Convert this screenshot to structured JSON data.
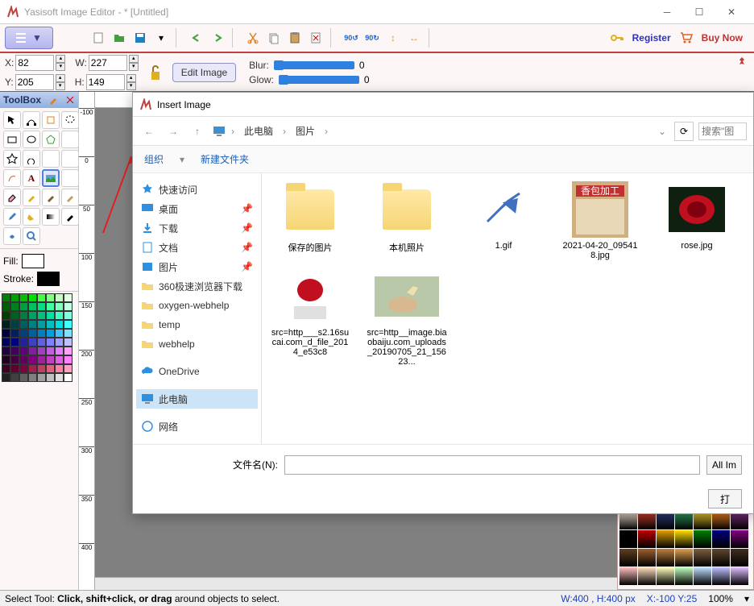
{
  "window": {
    "title": "Yasisoft Image Editor - * [Untitled]"
  },
  "toolbar": {
    "register": "Register",
    "buynow": "Buy Now"
  },
  "coords": {
    "x_label": "X:",
    "x": "82",
    "y_label": "Y:",
    "y": "205",
    "w_label": "W:",
    "w": "227",
    "h_label": "H:",
    "h": "149",
    "edit_image": "Edit Image",
    "blur_label": "Blur:",
    "blur_value": "0",
    "glow_label": "Glow:",
    "glow_value": "0"
  },
  "toolbox": {
    "title": "ToolBox",
    "fill_label": "Fill:",
    "stroke_label": "Stroke:"
  },
  "ruler_marks": [
    "-100",
    "0",
    "50",
    "100",
    "150",
    "200",
    "250",
    "300",
    "350",
    "400"
  ],
  "dialog": {
    "title": "Insert Image",
    "crumb1": "此电脑",
    "crumb2": "图片",
    "search_ph": "搜索\"图",
    "organize": "组织",
    "newfolder": "新建文件夹",
    "side": {
      "quick": "快速访问",
      "desktop": "桌面",
      "downloads": "下载",
      "documents": "文档",
      "pictures": "图片",
      "s360": "360极速浏览器下载",
      "oxygen": "oxygen-webhelp",
      "temp": "temp",
      "webhelp": "webhelp",
      "onedrive": "OneDrive",
      "thispc": "此电脑",
      "network": "网络"
    },
    "files": {
      "f1": "保存的图片",
      "f2": "本机照片",
      "f3": "1.gif",
      "f4": "2021-04-20_095418.jpg",
      "f5": "rose.jpg",
      "f6": "src=http___s2.16sucai.com_d_file_2014_e53c8",
      "f7": "src=http__image.biaobaiju.com_uploads_20190705_21_15623..."
    },
    "filename_label": "文件名(N):",
    "filter": "All Im",
    "open": "打"
  },
  "statusbar": {
    "tool_hint_prefix": "Select Tool: ",
    "tool_hint_bold": "Click, shift+click, or drag",
    "tool_hint_suffix": " around objects to select.",
    "dims": "W:400 , H:400 px",
    "xy": "X:-100    Y:25",
    "zoom": "100%"
  },
  "palette_colors": [
    "#008000",
    "#00a000",
    "#00c000",
    "#00e000",
    "#40ff40",
    "#80ff80",
    "#c0ffc0",
    "#e0ffe0",
    "#006000",
    "#008020",
    "#00a040",
    "#00c060",
    "#00e080",
    "#40ffa0",
    "#80ffc0",
    "#c0ffe0",
    "#004000",
    "#006020",
    "#008040",
    "#00a060",
    "#00c080",
    "#00e0a0",
    "#40ffc0",
    "#80ffe0",
    "#002020",
    "#004040",
    "#006060",
    "#008080",
    "#00a0a0",
    "#00c0c0",
    "#00e0e0",
    "#40ffff",
    "#000040",
    "#002060",
    "#004080",
    "#0060a0",
    "#0080c0",
    "#00a0e0",
    "#40c0ff",
    "#80e0ff",
    "#000060",
    "#000080",
    "#2020a0",
    "#4040c0",
    "#6060e0",
    "#8080ff",
    "#a0a0ff",
    "#c0c0ff",
    "#200040",
    "#400060",
    "#600080",
    "#8020a0",
    "#a040c0",
    "#c060e0",
    "#e080ff",
    "#ffa0ff",
    "#200020",
    "#400040",
    "#600060",
    "#800080",
    "#a020a0",
    "#c040c0",
    "#e060e0",
    "#ff80ff",
    "#400020",
    "#600030",
    "#800040",
    "#a02050",
    "#c04060",
    "#e06080",
    "#ff80a0",
    "#ffa0c0",
    "#202020",
    "#404040",
    "#606060",
    "#808080",
    "#a0a0a0",
    "#c0c0c0",
    "#e0e0e0",
    "#ffffff"
  ],
  "patterns": [
    "#f0e0d0",
    "#d04030",
    "#304080",
    "#30a060",
    "#f0d030",
    "#f08020",
    "#803080",
    "#000000",
    "#c00000",
    "#e0a000",
    "#ffe000",
    "#008000",
    "#000080",
    "#800080",
    "#604020",
    "#a06030",
    "#c08040",
    "#e0a050",
    "#806040",
    "#604830",
    "#403020",
    "#ffc0c0",
    "#ffe0c0",
    "#ffffc0",
    "#c0ffc0",
    "#c0e0ff",
    "#c0c0ff",
    "#e0c0ff"
  ]
}
